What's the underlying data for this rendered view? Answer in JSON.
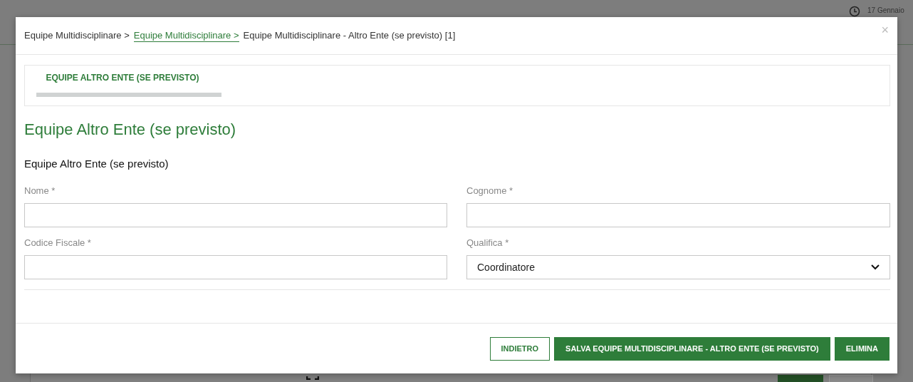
{
  "background_page": {
    "date": "17 Gennaio"
  },
  "modal": {
    "breadcrumb": [
      {
        "label": "Equipe Multidisciplinare >",
        "kind": "text"
      },
      {
        "label": "Equipe Multidisciplinare >",
        "kind": "link"
      },
      {
        "label": "Equipe Multidisciplinare - Altro Ente (se previsto) [1]",
        "kind": "current"
      }
    ],
    "close": "×",
    "tabs": [
      {
        "label": "EQUIPE ALTRO ENTE (SE PREVISTO)",
        "selected": true
      }
    ],
    "heading": "Equipe Altro Ente (se previsto)",
    "section_title": "Equipe Altro Ente (se previsto)",
    "fields": [
      {
        "label": "Nome *",
        "kind": "text"
      },
      {
        "label": "Cognome *",
        "kind": "text"
      },
      {
        "label": "Codice Fiscale *",
        "kind": "text"
      },
      {
        "label": "Qualifica *",
        "kind": "select",
        "value": "Coordinatore"
      }
    ],
    "buttons": [
      {
        "label": "INDIETRO",
        "kind": "outline"
      },
      {
        "label": "SALVA EQUIPE MULTIDISCIPLINARE - ALTRO ENTE (SE PREVISTO)",
        "kind": "primary"
      },
      {
        "label": "ELIMINA",
        "kind": "primary"
      }
    ]
  }
}
